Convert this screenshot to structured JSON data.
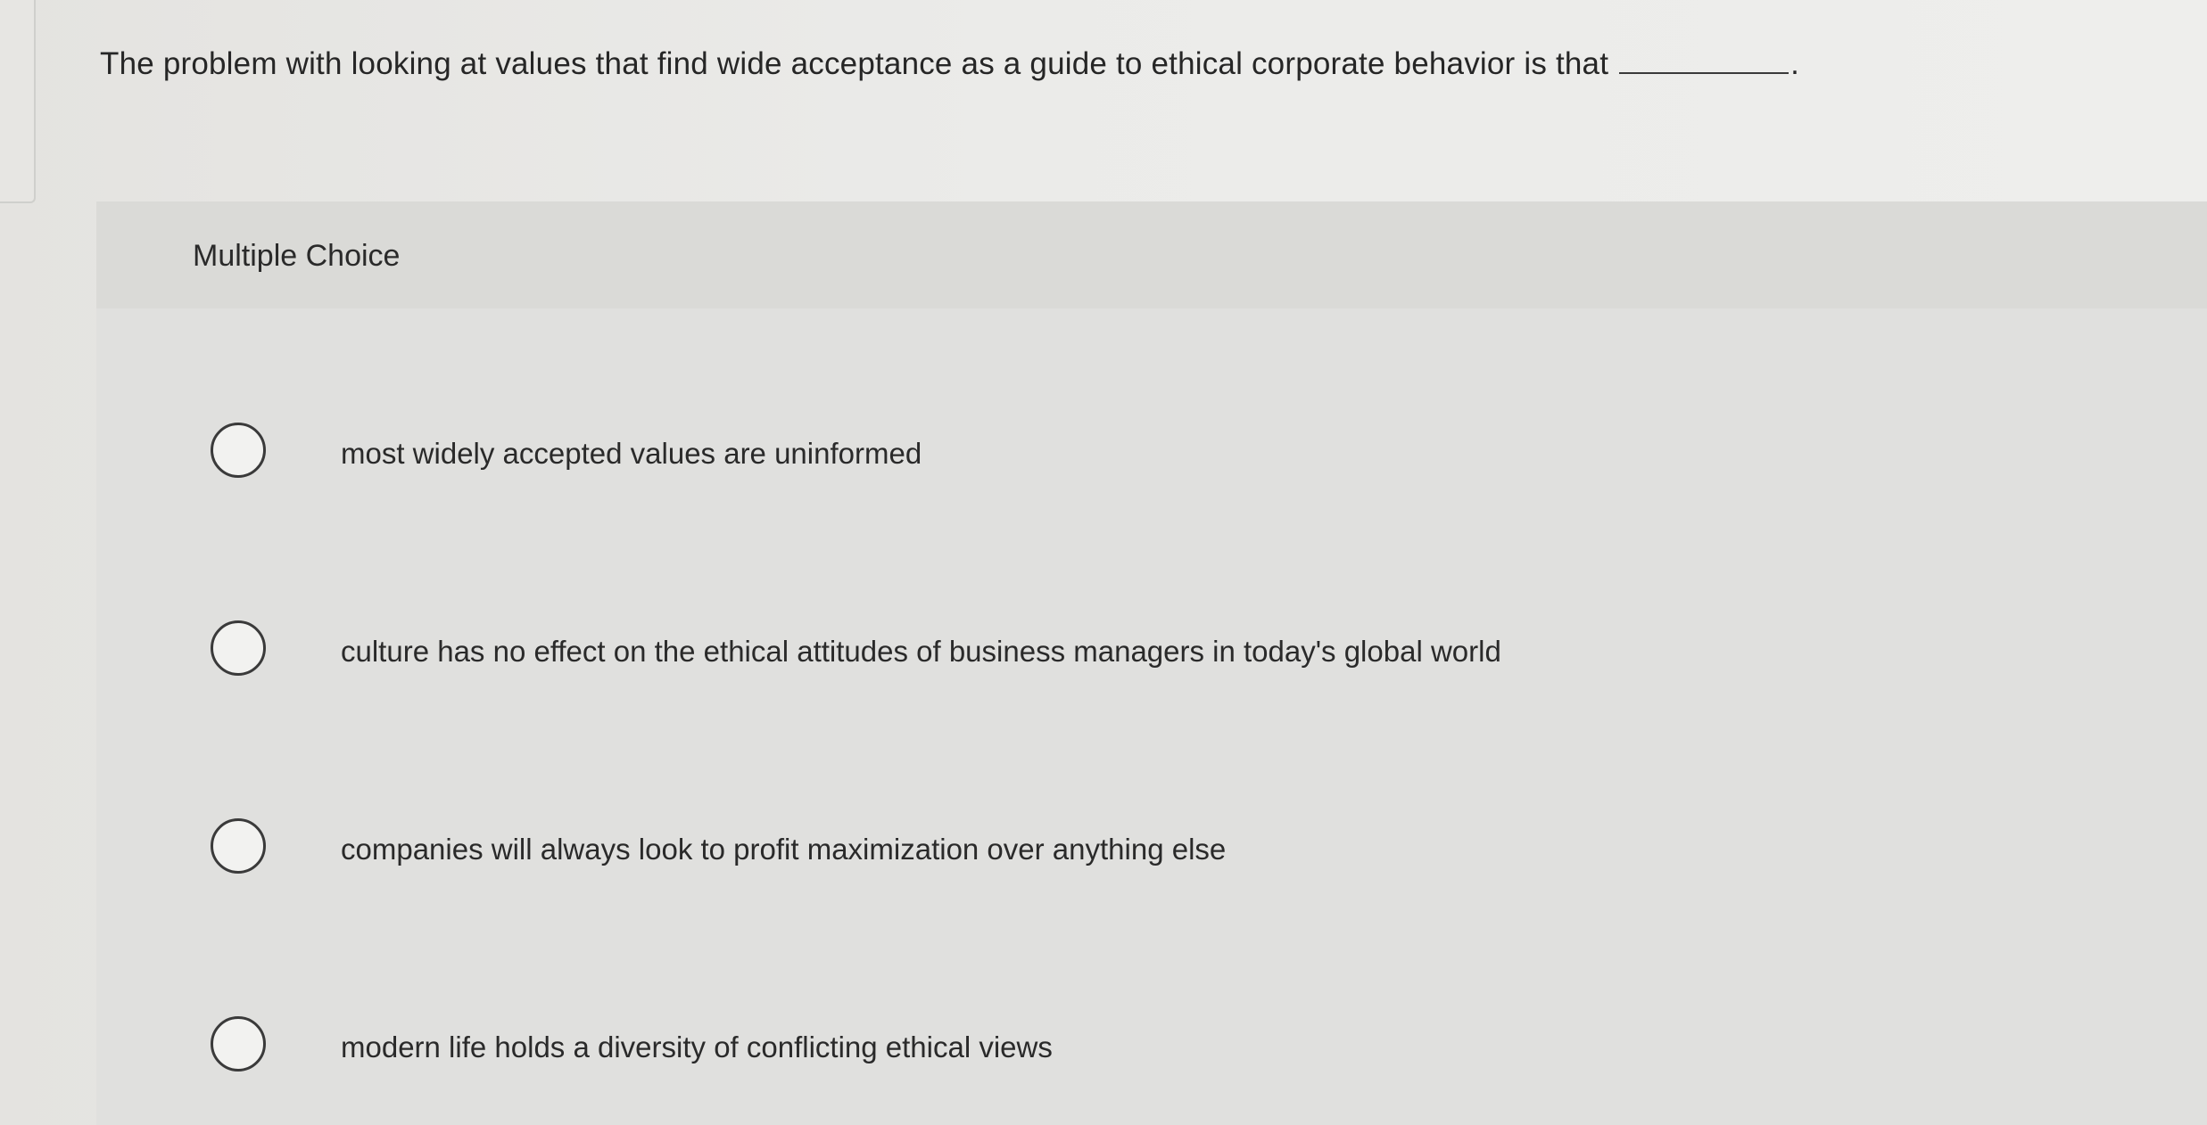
{
  "question": {
    "text": "The problem with looking at values that find wide acceptance as a guide to ethical corporate behavior is that",
    "blank_suffix": "."
  },
  "panel": {
    "title": "Multiple Choice"
  },
  "options": [
    {
      "label": "most widely accepted values are uninformed"
    },
    {
      "label": "culture has no effect on the ethical attitudes of business managers in today's global world"
    },
    {
      "label": "companies will always look to profit maximization over anything else"
    },
    {
      "label": "modern life holds a diversity of conflicting ethical views"
    }
  ]
}
